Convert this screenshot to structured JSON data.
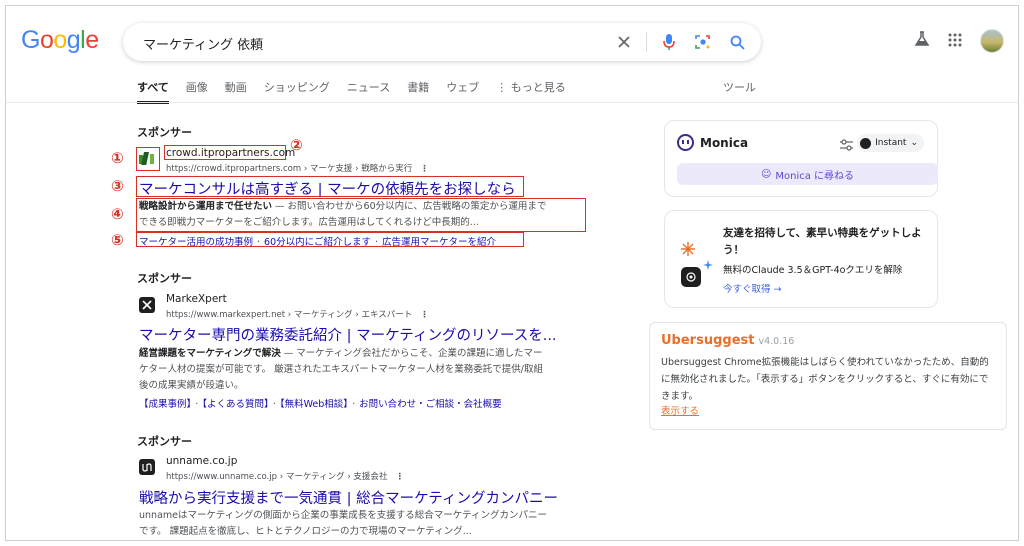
{
  "logo": {
    "text": "Google"
  },
  "search": {
    "query": "マーケティング 依頼"
  },
  "tabs": [
    {
      "label": "すべて"
    },
    {
      "label": "画像"
    },
    {
      "label": "動画"
    },
    {
      "label": "ショッピング"
    },
    {
      "label": "ニュース"
    },
    {
      "label": "書籍"
    },
    {
      "label": "ウェブ"
    },
    {
      "label": "もっと見る"
    }
  ],
  "tools_label": "ツール",
  "results": [
    {
      "sponsor": "スポンサー",
      "site_name": "crowd.itpropartners.com",
      "url": "https://crowd.itpropartners.com › マーケ支援 › 戦略から実行",
      "title": "マーケコンサルは高すぎる | マーケの依頼先をお探しなら",
      "snippet_bold": "戦略設計から運用まで任せたい",
      "snippet_rest": " — お問い合わせから60分以内に、広告戦略の策定から運用まで",
      "snippet_line2": "できる即戦力マーケターをご紹介します。広告運用はしてくれるけど中長期的...",
      "sitelinks": [
        "マーケター活用の成功事例",
        "60分以内にご紹介します",
        "広告運用マーケターを紹介"
      ]
    },
    {
      "sponsor": "スポンサー",
      "site_name": "MarkeXpert",
      "url": "https://www.markexpert.net › マーケティング › エキスパート",
      "title": "マーケター専門の業務委託紹介 | マーケティングのリソースを...",
      "snippet_bold": "経営課題をマーケティングで解決",
      "snippet_rest": " — マーケティング会社だからこそ、企業の課題に適したマー",
      "snippet_line2": "ケター人材の提案が可能です。 厳選されたエキスパートマーケター人材を業務委託で提供/取組",
      "snippet_line3": "後の成果実績が段違い。",
      "sitelinks": [
        "【成果事例】",
        "【よくある質問】",
        "【無料Web相談】",
        "お問い合わせ・ご相談・会社概要"
      ]
    },
    {
      "sponsor": "スポンサー",
      "site_name": "unname.co.jp",
      "url": "https://www.unname.co.jp › マーケティング › 支援会社",
      "title": "戦略から実行支援まで一気通貫 | 総合マーケティングカンパニー",
      "snippet_line1": "unnameはマーケティングの側面から企業の事業成長を支援する総合マーケティングカンパニー",
      "snippet_line2": "です。 課題起点を徹底し、ヒトとテクノロジーの力で現場のマーケティング..."
    }
  ],
  "markers": [
    "①",
    "②",
    "③",
    "④",
    "⑤"
  ],
  "monica": {
    "name": "Monica",
    "mode": "Instant",
    "ask_button": "Monica に尋ねる"
  },
  "invite": {
    "title": "友達を招待して、素早い特典をゲットしよう！",
    "desc": "無料のClaude 3.5＆GPT-4oクエリを解除",
    "link": "今すぐ取得 →"
  },
  "ubersuggest": {
    "name": "Ubersuggest",
    "version": "v4.0.16",
    "body": "Ubersuggest Chrome拡張機能はしばらく使われていなかったため、自動的に無効化されました。「表示する」ボタンをクリックすると、すぐに有効にできます。",
    "link": "表示する"
  },
  "colors": {
    "link": "#1a0dab",
    "annotation": "#d93025",
    "ubersuggest": "#e8702a",
    "monica_accent": "#5b4bd1"
  }
}
